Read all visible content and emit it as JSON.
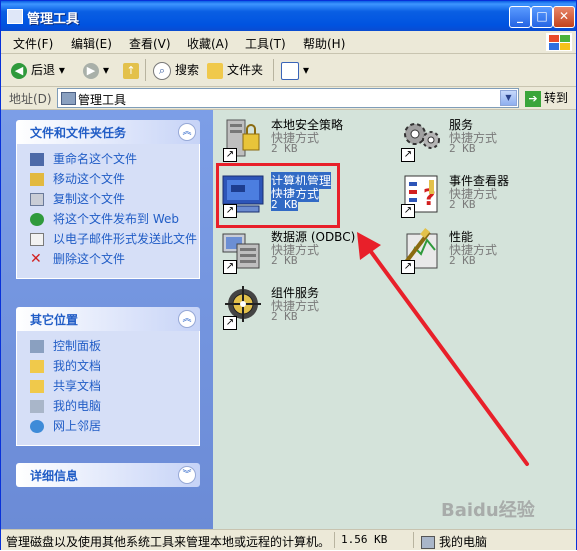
{
  "window": {
    "title": "管理工具"
  },
  "menu": [
    "文件(F)",
    "编辑(E)",
    "查看(V)",
    "收藏(A)",
    "工具(T)",
    "帮助(H)"
  ],
  "toolbar": {
    "back": "后退",
    "search": "搜索",
    "folders": "文件夹"
  },
  "address": {
    "label": "地址(D)",
    "value": "管理工具",
    "go": "转到"
  },
  "sidebar": {
    "tasks": {
      "title": "文件和文件夹任务",
      "items": [
        "重命名这个文件",
        "移动这个文件",
        "复制这个文件",
        "将这个文件发布到 Web",
        "以电子邮件形式发送此文件",
        "删除这个文件"
      ]
    },
    "places": {
      "title": "其它位置",
      "items": [
        "控制面板",
        "我的文档",
        "共享文档",
        "我的电脑",
        "网上邻居"
      ]
    },
    "details": {
      "title": "详细信息"
    }
  },
  "files": [
    {
      "name": "本地安全策略",
      "kind": "快捷方式",
      "size": "2 KB"
    },
    {
      "name": "服务",
      "kind": "快捷方式",
      "size": "2 KB"
    },
    {
      "name": "计算机管理",
      "kind": "快捷方式",
      "size": "2 KB",
      "selected": true
    },
    {
      "name": "事件查看器",
      "kind": "快捷方式",
      "size": "2 KB"
    },
    {
      "name": "数据源 (ODBC)",
      "kind": "快捷方式",
      "size": "2 KB"
    },
    {
      "name": "性能",
      "kind": "快捷方式",
      "size": "2 KB"
    },
    {
      "name": "组件服务",
      "kind": "快捷方式",
      "size": "2 KB"
    }
  ],
  "status": {
    "description": "管理磁盘以及使用其他系统工具来管理本地或远程的计算机。",
    "size": "1.56 KB",
    "location": "我的电脑"
  },
  "watermark": "Baidu经验",
  "colors": {
    "highlight": "#e8202a",
    "selection": "#316ac5",
    "task_link": "#215dc6"
  }
}
